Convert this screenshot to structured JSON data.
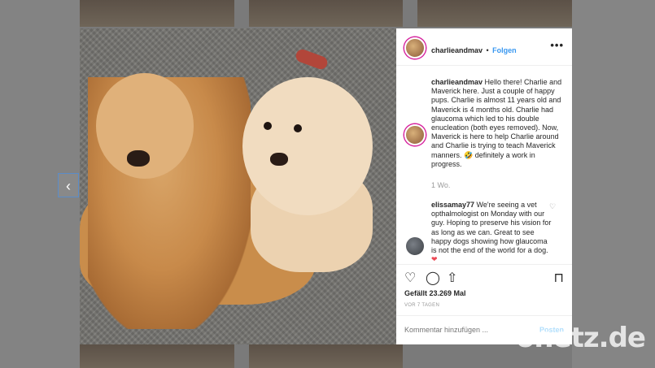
{
  "post": {
    "username": "charlieandmav",
    "separator": "•",
    "follow_label": "Folgen",
    "more_label": "•••",
    "caption_user": "charlieandmav",
    "caption_text": " Hello there! Charlie and Maverick here. Just a couple of happy pups. Charlie is almost 11 years old and Maverick is 4 months old. Charlie had glaucoma which led to his double enucleation (both eyes removed). Now, Maverick is here to help Charlie around and Charlie is trying to teach Maverick manners. 🤣 definitely a work in progress.",
    "caption_time": "1 Wo.",
    "comment_user": "elissamay77",
    "comment_text": " We're seeing a vet opthalmologist on Monday with our guy. Hoping to preserve his vision for as long as we can. Great to see happy dogs showing how glaucoma is not the end of the world for a dog.",
    "comment_heart": "❤",
    "likes": "Gefällt 23.269 Mal",
    "posted_ago": "VOR 7 TAGEN",
    "add_comment_placeholder": "Kommentar hinzufügen ...",
    "post_label": "Posten"
  },
  "icons": {
    "like": "♡",
    "comment": "◯",
    "share": "⇧",
    "save": "⊓",
    "prev": "‹",
    "small_heart": "♡"
  },
  "watermark": "onetz.de",
  "colors": {
    "link": "#3897f0",
    "post_disabled": "#b2dffc",
    "story_ring": "#d6249f"
  }
}
